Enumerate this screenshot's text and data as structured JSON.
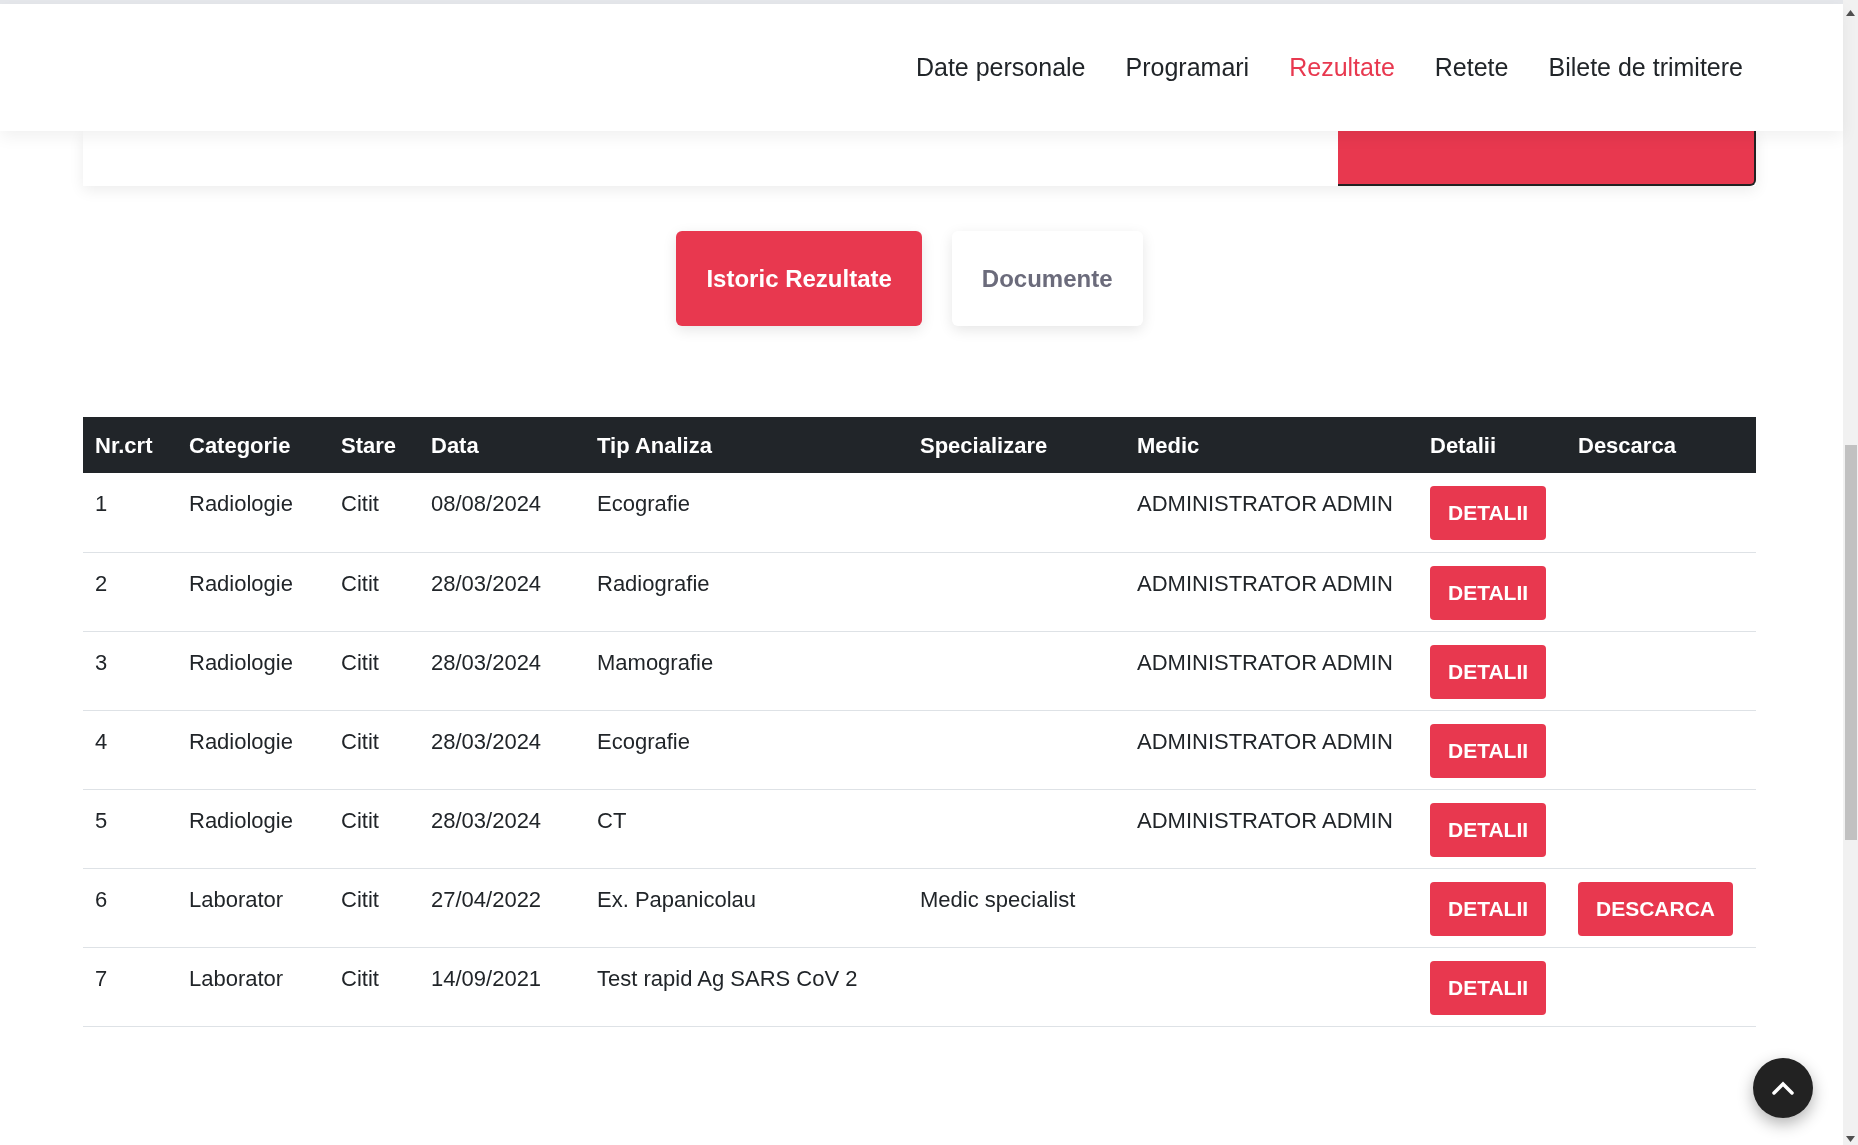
{
  "nav": {
    "items": [
      {
        "label": "Date personale",
        "selected": false
      },
      {
        "label": "Programari",
        "selected": false
      },
      {
        "label": "Rezultate",
        "selected": true
      },
      {
        "label": "Retete",
        "selected": false
      },
      {
        "label": "Bilete de trimitere",
        "selected": false
      }
    ]
  },
  "tabs": [
    {
      "label": "Istoric Rezultate",
      "selected": true
    },
    {
      "label": "Documente",
      "selected": false
    }
  ],
  "table": {
    "columns": [
      "Nr.crt",
      "Categorie",
      "Stare",
      "Data",
      "Tip Analiza",
      "Specializare",
      "Medic",
      "Detalii",
      "Descarca"
    ],
    "rows": [
      {
        "nr": "1",
        "categorie": "Radiologie",
        "stare": "Citit",
        "data": "08/08/2024",
        "tip": "Ecografie",
        "specializare": "",
        "medic": "ADMINISTRATOR ADMIN",
        "detalii": "DETALII"
      },
      {
        "nr": "2",
        "categorie": "Radiologie",
        "stare": "Citit",
        "data": "28/03/2024",
        "tip": "Radiografie",
        "medic": "ADMINISTRATOR ADMIN",
        "detalii": "DETALII"
      },
      {
        "nr": "3",
        "categorie": "Radiologie",
        "stare": "Citit",
        "data": "28/03/2024",
        "tip": "Mamografie",
        "medic": "ADMINISTRATOR ADMIN",
        "detalii": "DETALII"
      },
      {
        "nr": "4",
        "categorie": "Radiologie",
        "stare": "Citit",
        "data": "28/03/2024",
        "tip": "Ecografie",
        "medic": "ADMINISTRATOR ADMIN",
        "detalii": "DETALII"
      },
      {
        "nr": "5",
        "categorie": "Radiologie",
        "stare": "Citit",
        "data": "28/03/2024",
        "tip": "CT",
        "medic": "ADMINISTRATOR ADMIN",
        "detalii": "DETALII"
      },
      {
        "nr": "6",
        "categorie": "Laborator",
        "stare": "Citit",
        "data": "27/04/2022",
        "tip": "Ex. Papanicolau",
        "specializare": "Medic specialist",
        "detalii": "DETALII",
        "descarca": "DESCARCA"
      },
      {
        "nr": "7",
        "categorie": "Laborator",
        "stare": "Citit",
        "data": "14/09/2021",
        "tip": "Test rapid Ag SARS CoV 2",
        "detalii": "DETALII"
      }
    ]
  }
}
